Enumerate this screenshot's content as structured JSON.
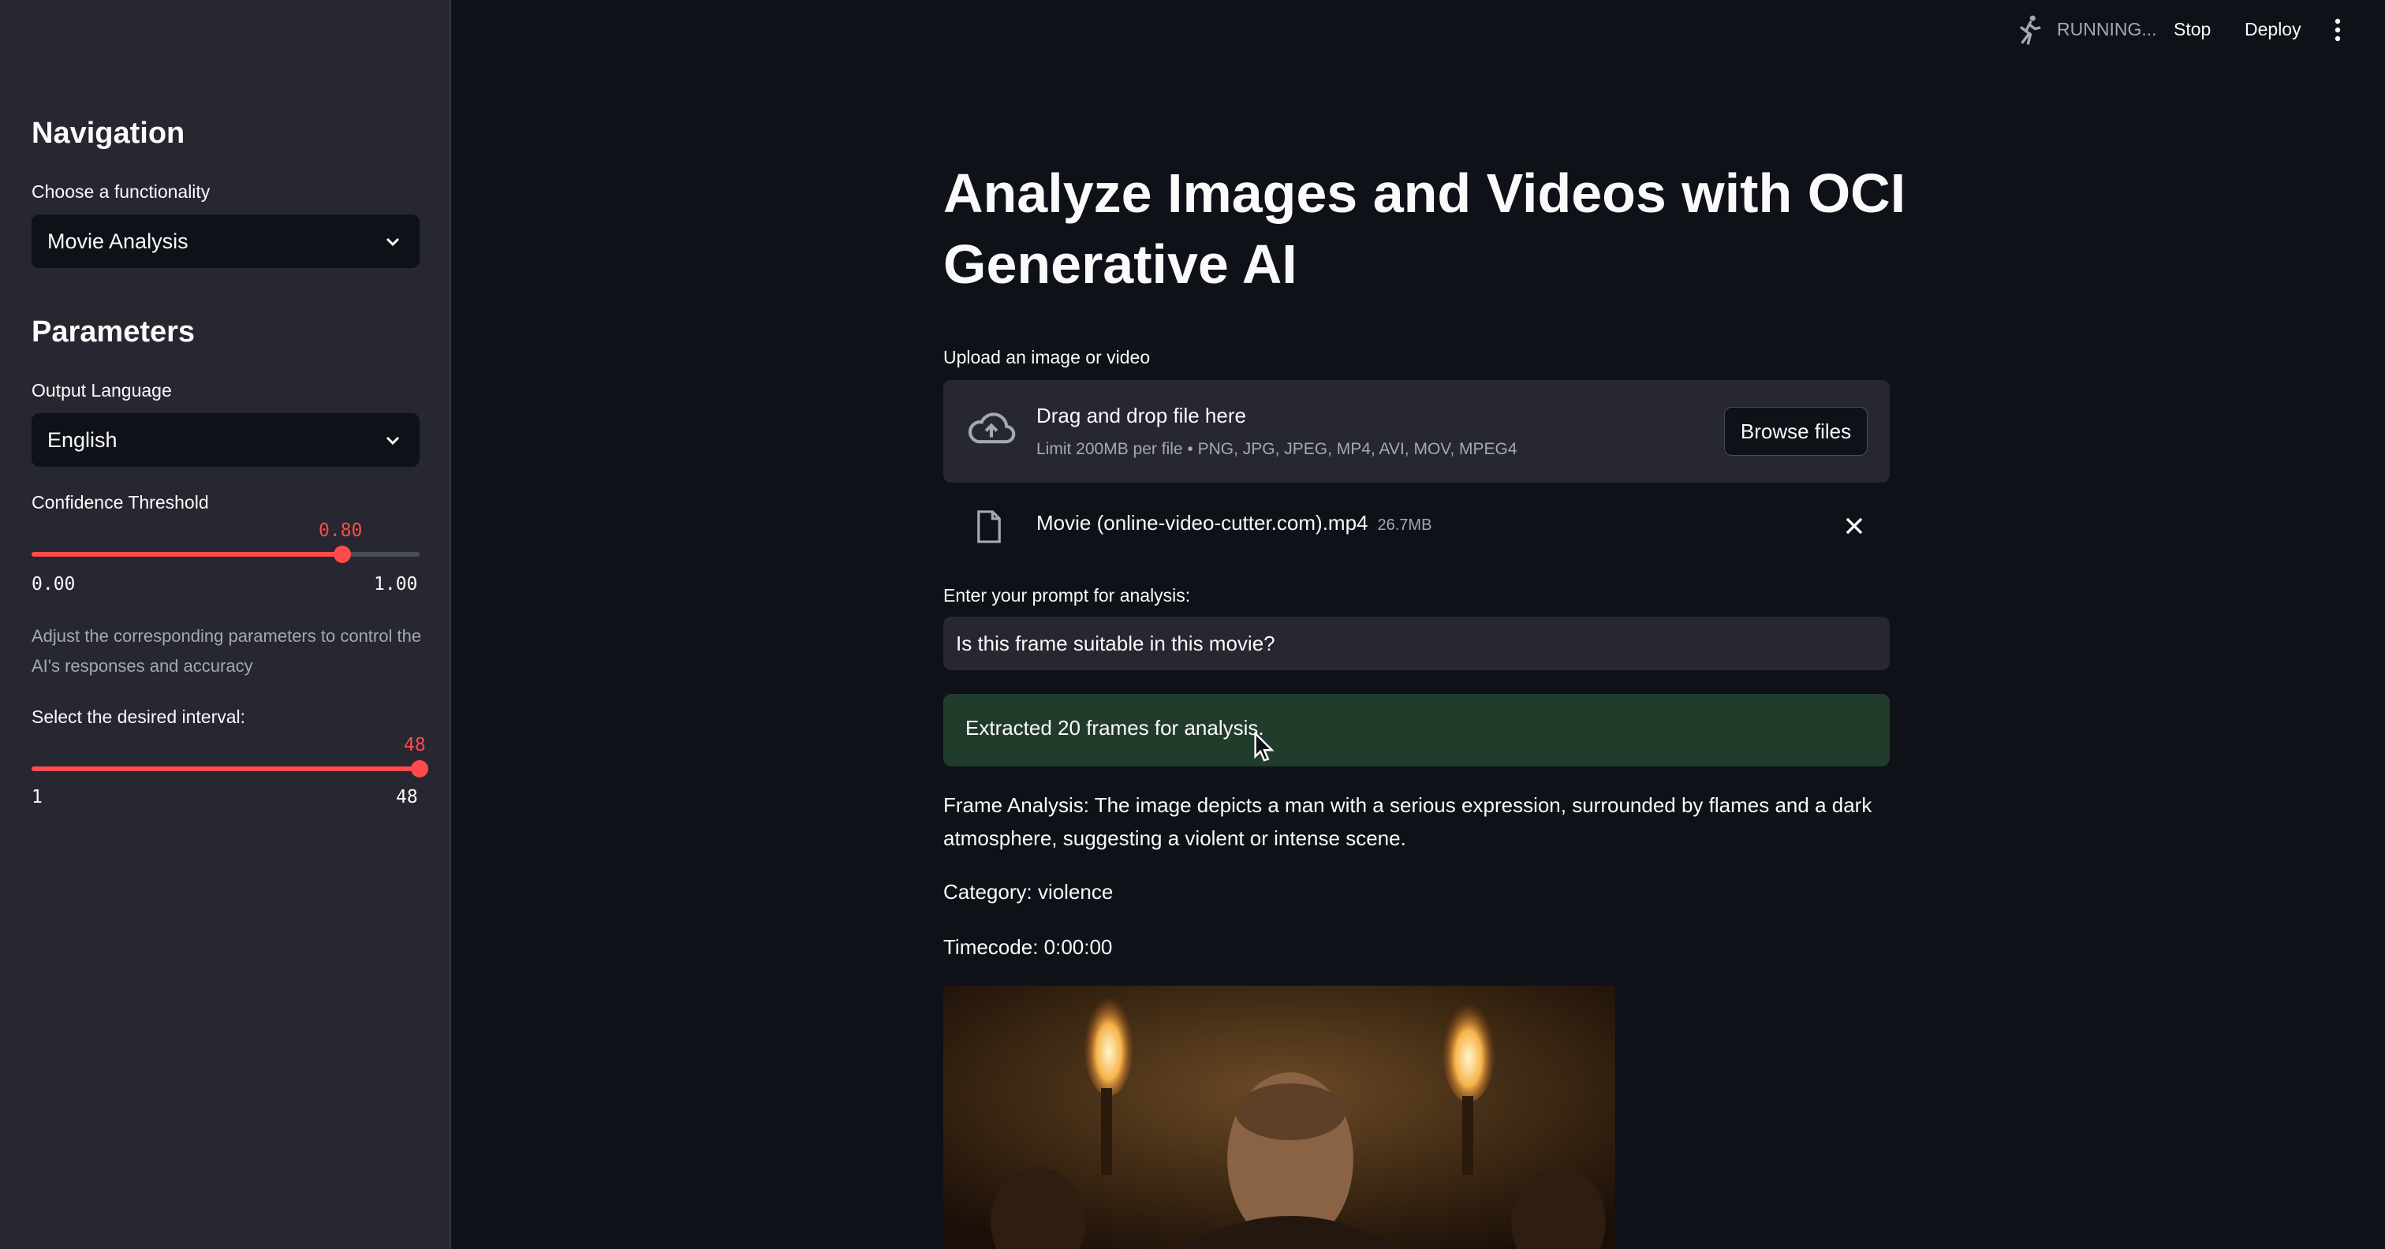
{
  "topbar": {
    "status": "RUNNING...",
    "stop": "Stop",
    "deploy": "Deploy",
    "running_icon": "running-man-icon",
    "menu_icon": "kebab-menu-icon"
  },
  "sidebar": {
    "nav_heading": "Navigation",
    "functionality_label": "Choose a functionality",
    "functionality_value": "Movie Analysis",
    "params_heading": "Parameters",
    "language_label": "Output Language",
    "language_value": "English",
    "confidence": {
      "label": "Confidence Threshold",
      "value": "0.80",
      "min": "0.00",
      "max": "1.00",
      "fraction": 0.8
    },
    "help_text": "Adjust the corresponding parameters to control the AI's responses and accuracy",
    "interval": {
      "label": "Select the desired interval:",
      "value": "48",
      "min": "1",
      "max": "48",
      "fraction": 1.0
    }
  },
  "main": {
    "title": "Analyze Images and Videos with OCI Generative AI",
    "upload_label": "Upload an image or video",
    "upload_title": "Drag and drop file here",
    "upload_limit": "Limit 200MB per file • PNG, JPG, JPEG, MP4, AVI, MOV, MPEG4",
    "browse": "Browse files",
    "file_name": "Movie (online-video-cutter.com).mp4",
    "file_size": "26.7MB",
    "prompt_label": "Enter your prompt for analysis:",
    "prompt_value": "Is this frame suitable in this movie?",
    "success": "Extracted 20 frames for analysis.",
    "frame_analysis": "Frame Analysis: The image depicts a man with a serious expression, surrounded by flames and a dark atmosphere, suggesting a violent or intense scene.",
    "category": "Category: violence",
    "timecode": "Timecode: 0:00:00"
  },
  "colors": {
    "accent": "#ff4b4b",
    "background": "#0e1117",
    "sidebar": "#262730",
    "success_bg": "#223c2c"
  }
}
